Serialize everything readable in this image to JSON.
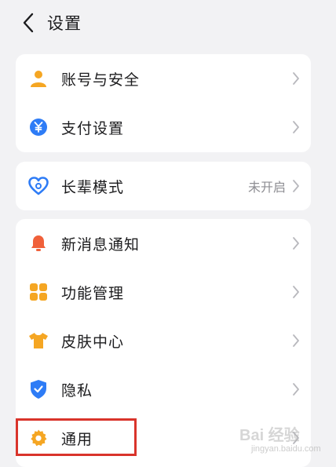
{
  "header": {
    "title": "设置",
    "back_icon": "chevron-left-icon"
  },
  "account_card": {
    "items": [
      {
        "label": "账号与安全",
        "icon": "user-icon",
        "icon_color": "#f5a623"
      },
      {
        "label": "支付设置",
        "icon": "yuan-coin-icon",
        "icon_color": "#2e7cf6",
        "icon_glyph": "¥"
      }
    ]
  },
  "elder_card": {
    "item": {
      "label": "长辈模式",
      "value": "未开启",
      "icon": "heart-outline-icon",
      "icon_color": "#2e7cf6"
    }
  },
  "general_card": {
    "items": [
      {
        "label": "新消息通知",
        "icon": "bell-icon",
        "icon_color": "#f0603a"
      },
      {
        "label": "功能管理",
        "icon": "grid-apps-icon",
        "icon_color": "#f5a623"
      },
      {
        "label": "皮肤中心",
        "icon": "tshirt-icon",
        "icon_color": "#f5a623"
      },
      {
        "label": "隐私",
        "icon": "shield-check-icon",
        "icon_color": "#2e7cf6"
      },
      {
        "label": "通用",
        "icon": "gear-icon",
        "icon_color": "#f5a623"
      }
    ]
  },
  "highlight_color": "#d9342b",
  "watermark": {
    "main": "Bai 经验",
    "sub": "jingyan.baidu.com"
  }
}
